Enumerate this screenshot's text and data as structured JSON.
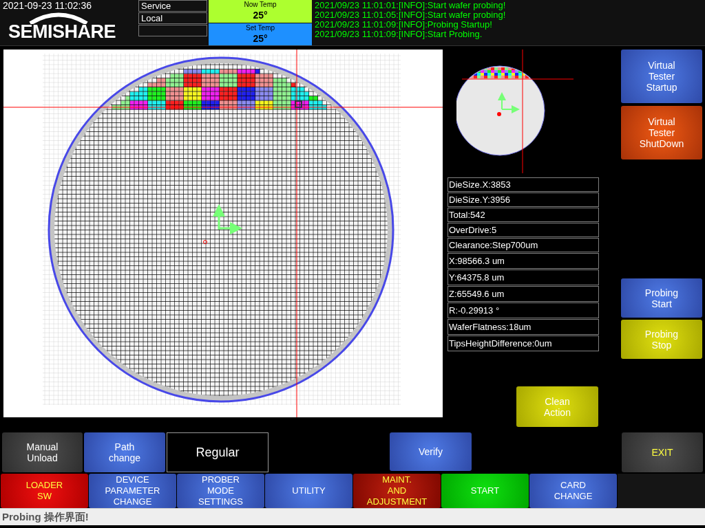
{
  "header": {
    "datetime": "2021-09-23 11:02:36",
    "logo": "SEMISHARE",
    "mode_fields": [
      "Service",
      "Local"
    ],
    "temps": [
      {
        "kind": "now",
        "label": "Now Temp",
        "value": "25°"
      },
      {
        "kind": "set",
        "label": "Set Temp",
        "value": "25°"
      }
    ],
    "log": [
      "2021/09/23 11:01:01:[INFO]:Start wafer probing!",
      "2021/09/23 11:01:05:[INFO]:Start wafer probing!",
      "2021/09/23 11:01:09:[INFO]:Probing Startup!",
      "2021/09/23 11:01:09:[INFO]:Start Probing."
    ]
  },
  "info": [
    "DieSize.X:3853",
    "DieSize.Y:3956",
    "Total:542",
    "OverDrive:5",
    "Clearance:Step700um",
    "X:98566.3 um",
    "Y:64375.8 um",
    "Z:65549.6 um",
    "R:-0.29913 °",
    "WaferFlatness:18um",
    "TipsHeightDifference:0um"
  ],
  "side_buttons_top": [
    {
      "label": "Virtual\nTester\nStartup",
      "kind": "blue"
    },
    {
      "label": "Virtual\nTester\nShutDown",
      "kind": "orange"
    }
  ],
  "side_buttons_bottom": [
    {
      "label": "Probing\nStart",
      "kind": "blue"
    },
    {
      "label": "Probing\nStop",
      "kind": "yellow"
    }
  ],
  "clean_button": {
    "label": "Clean\nAction",
    "kind": "yellow"
  },
  "action_row": {
    "manual_unload": {
      "label": "Manual\nUnload",
      "kind": "gray"
    },
    "path_change": {
      "label": "Path\nchange",
      "kind": "blue"
    },
    "path_mode": "Regular",
    "verify": {
      "label": "Verify",
      "kind": "blue"
    },
    "exit": {
      "label": "EXIT",
      "kind": "grayyellow"
    }
  },
  "menu": [
    {
      "label": "LOADER\nSW",
      "kind": "red"
    },
    {
      "label": "DEVICE\nPARAMETER\nCHANGE",
      "kind": "blue"
    },
    {
      "label": "PROBER\nMODE\nSETTINGS",
      "kind": "blue"
    },
    {
      "label": "UTILITY",
      "kind": "blue"
    },
    {
      "label": "MAINT.\nAND\nADJUSTMENT",
      "kind": "darkred"
    },
    {
      "label": "START",
      "kind": "green"
    },
    {
      "label": "CARD\nCHANGE",
      "kind": "blue"
    }
  ],
  "status_bar": "Probing 操作界面!"
}
